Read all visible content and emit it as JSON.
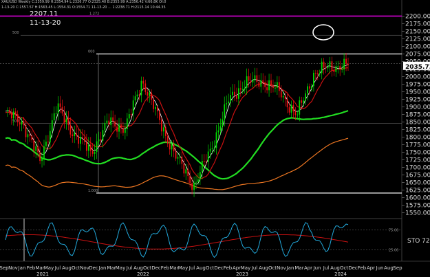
{
  "header": {
    "symbol_line": "XAU/USD  Weekly  C:2359.99  H:2354.94  L:2326.77  O:2325.40  B:2355.99  A:2356.42  V:66.8K  OI:0",
    "sub_line": "1-13-20  C:1557.57  H:1563.45  L:1554.31  O:1554.71   11-13-20 ...  1:2238.71  H:2115.14  10:44.35"
  },
  "cursor_label": {
    "value": "2207.11",
    "date": "11-13-20"
  },
  "price_axis": {
    "ticks": [
      2200,
      2175,
      2150,
      2125,
      2100,
      2075,
      2050,
      2025,
      2000,
      1975,
      1950,
      1925,
      1900,
      1875,
      1850,
      1825,
      1800,
      1775,
      1750,
      1725,
      1700,
      1675,
      1650,
      1625,
      1600,
      1575,
      1550
    ],
    "last_price": "2035.73",
    "min": 1537.5,
    "max": 2212.5
  },
  "fib_labels": [
    "1.272",
    "500",
    "000",
    "500",
    "1.000"
  ],
  "stochastic": {
    "label": "STO",
    "value": "72",
    "levels": [
      75,
      25
    ]
  },
  "time_axis": {
    "months": [
      "Sep",
      "Nov",
      "Jan",
      "Feb",
      "Mar",
      "May",
      "Jul",
      "Aug",
      "Oct",
      "Nov",
      "Dec",
      "Jan",
      "Mar",
      "May",
      "Jul",
      "Aug",
      "Oct",
      "Dec",
      "Feb",
      "Mar",
      "May",
      "Jul",
      "Aug",
      "Oct",
      "Dec",
      "Feb",
      "Apr",
      "May",
      "Jul",
      "Aug",
      "Oct",
      "Nov",
      "Jan",
      "Mar",
      "Apr",
      "Jun",
      "Jul",
      "Aug",
      "Oct",
      "Dec",
      "Feb",
      "Apr",
      "Jun",
      "Aug",
      "Sep"
    ],
    "years": [
      "2021",
      "2022",
      "2023",
      "2024"
    ]
  },
  "colors": {
    "background": "#000000",
    "bull": "#00dd00",
    "bear": "#ee1111",
    "sma_short": "#ffffff",
    "sma_mid": "#cc1111",
    "sma_long": "#22dd22",
    "sma_longest": "#ee7722",
    "stoch_k": "#22aadd",
    "stoch_d": "#cc1111",
    "fib_top": "#aa00aa",
    "circle": "#ffffff"
  },
  "chart_data": {
    "type": "candlestick",
    "title": "XAU/USD Weekly",
    "ylim": [
      1537.5,
      2212.5
    ],
    "x": [
      "2020-11",
      "2021-01",
      "2021-03",
      "2021-05",
      "2021-07",
      "2021-09",
      "2021-11",
      "2022-01",
      "2022-03",
      "2022-05",
      "2022-07",
      "2022-09",
      "2022-11",
      "2023-01",
      "2023-03",
      "2023-05",
      "2023-07",
      "2023-09",
      "2023-11",
      "2024-01",
      "2024-02"
    ],
    "close": [
      1880,
      1850,
      1720,
      1900,
      1810,
      1750,
      1850,
      1830,
      1990,
      1850,
      1730,
      1640,
      1760,
      1920,
      1980,
      1985,
      1950,
      1870,
      2010,
      2035,
      2035.73
    ],
    "overlays": [
      "SMA short",
      "SMA mid",
      "SMA long",
      "SMA longest",
      "Fibonacci levels",
      "Stochastic oscillator"
    ],
    "highlight": "circle around 2150 high in Dec 2023"
  }
}
